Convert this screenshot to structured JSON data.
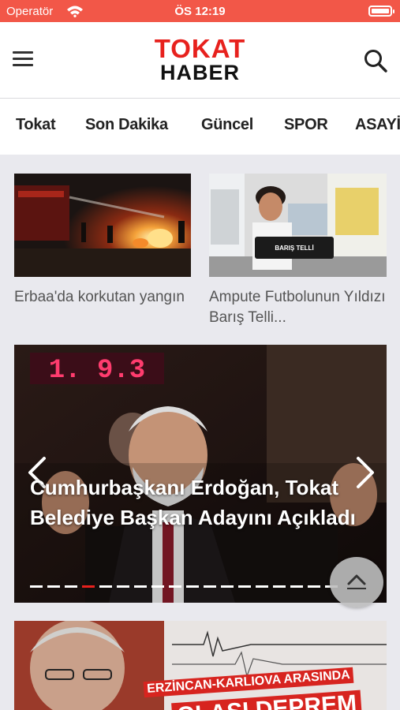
{
  "status_bar": {
    "carrier": "Operatör",
    "time": "ÖS 12:19"
  },
  "header": {
    "logo_line1": "TOKAT",
    "logo_line2": "HABER"
  },
  "categories": [
    "Tokat",
    "Son Dakika",
    "Güncel",
    "SPOR",
    "ASAYİŞ"
  ],
  "news": [
    {
      "title": "Erbaa'da korkutan yangın"
    },
    {
      "title": "Ampute Futbolunun Yıldızı Barış Telli..."
    }
  ],
  "news_images": {
    "fire_scene": {
      "colors": [
        "#1b1412",
        "#e85a1c",
        "#f4b23a",
        "#5b1410"
      ]
    },
    "player_photo": {
      "chair_label": "BARIŞ TELLİ"
    }
  },
  "slider": {
    "title": "Cumhurbaşkanı Erdoğan, Tokat Belediye Başkan Adayını Açıkladı",
    "display_text": "1. 9.3",
    "dot_count": 18,
    "active_index": 3
  },
  "bottom_story": {
    "banner_line1": "ERZİNCAN-KARLIOVA ARASINDA",
    "banner_line2": "OLASI DEPREM"
  },
  "colors": {
    "brand_red": "#e7211d",
    "status_bar": "#f25748",
    "active_dot": "#e7211d"
  }
}
